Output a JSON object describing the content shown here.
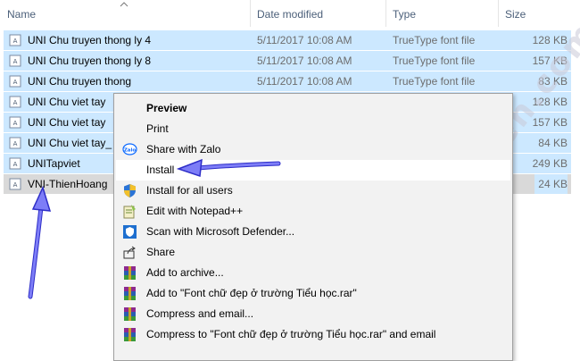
{
  "columns": {
    "name": "Name",
    "date": "Date modified",
    "type": "Type",
    "size": "Size"
  },
  "files": [
    {
      "name": "UNI Chu truyen thong ly 4",
      "date": "5/11/2017 10:08 AM",
      "type": "TrueType font file",
      "size": "128 KB",
      "selected": true
    },
    {
      "name": "UNI Chu truyen thong ly 8",
      "date": "5/11/2017 10:08 AM",
      "type": "TrueType font file",
      "size": "157 KB",
      "selected": true
    },
    {
      "name": "UNI Chu truyen thong",
      "date": "5/11/2017 10:08 AM",
      "type": "TrueType font file",
      "size": "83 KB",
      "selected": true
    },
    {
      "name": "UNI Chu viet tay",
      "date": "",
      "type": "",
      "size": "128 KB",
      "selected": true
    },
    {
      "name": "UNI Chu viet tay",
      "date": "",
      "type": "",
      "size": "157 KB",
      "selected": true
    },
    {
      "name": "UNI Chu viet tay_",
      "date": "",
      "type": "",
      "size": "84 KB",
      "selected": true
    },
    {
      "name": "UNITapviet",
      "date": "",
      "type": "",
      "size": "249 KB",
      "selected": true
    },
    {
      "name": "VNI-ThienHoang",
      "date": "",
      "type": "",
      "size": "24 KB",
      "selected": false
    }
  ],
  "context_menu": {
    "items": [
      {
        "label": "Preview",
        "icon": "none",
        "bold": true
      },
      {
        "label": "Print",
        "icon": "none"
      },
      {
        "label": "Share with Zalo",
        "icon": "zalo-icon"
      },
      {
        "label": "Install",
        "icon": "none",
        "highlighted": true
      },
      {
        "label": "Install for all users",
        "icon": "shield-icon"
      },
      {
        "label": "Edit with Notepad++",
        "icon": "notepad-plus-plus-icon"
      },
      {
        "label": "Scan with Microsoft Defender...",
        "icon": "defender-icon"
      },
      {
        "label": "Share",
        "icon": "share-icon"
      },
      {
        "label": "Add to archive...",
        "icon": "winrar-icon"
      },
      {
        "label": "Add to \"Font chữ đẹp ở trường Tiểu học.rar\"",
        "icon": "winrar-icon"
      },
      {
        "label": "Compress and email...",
        "icon": "winrar-icon"
      },
      {
        "label": "Compress to \"Font chữ đẹp ở trường Tiểu học.rar\" and email",
        "icon": "winrar-icon"
      }
    ]
  },
  "watermark": "taimien.com",
  "colors": {
    "selection": "#cce8ff",
    "menu_bg": "#f2f2f2",
    "annotation_arrow": "#6b6bf5"
  }
}
